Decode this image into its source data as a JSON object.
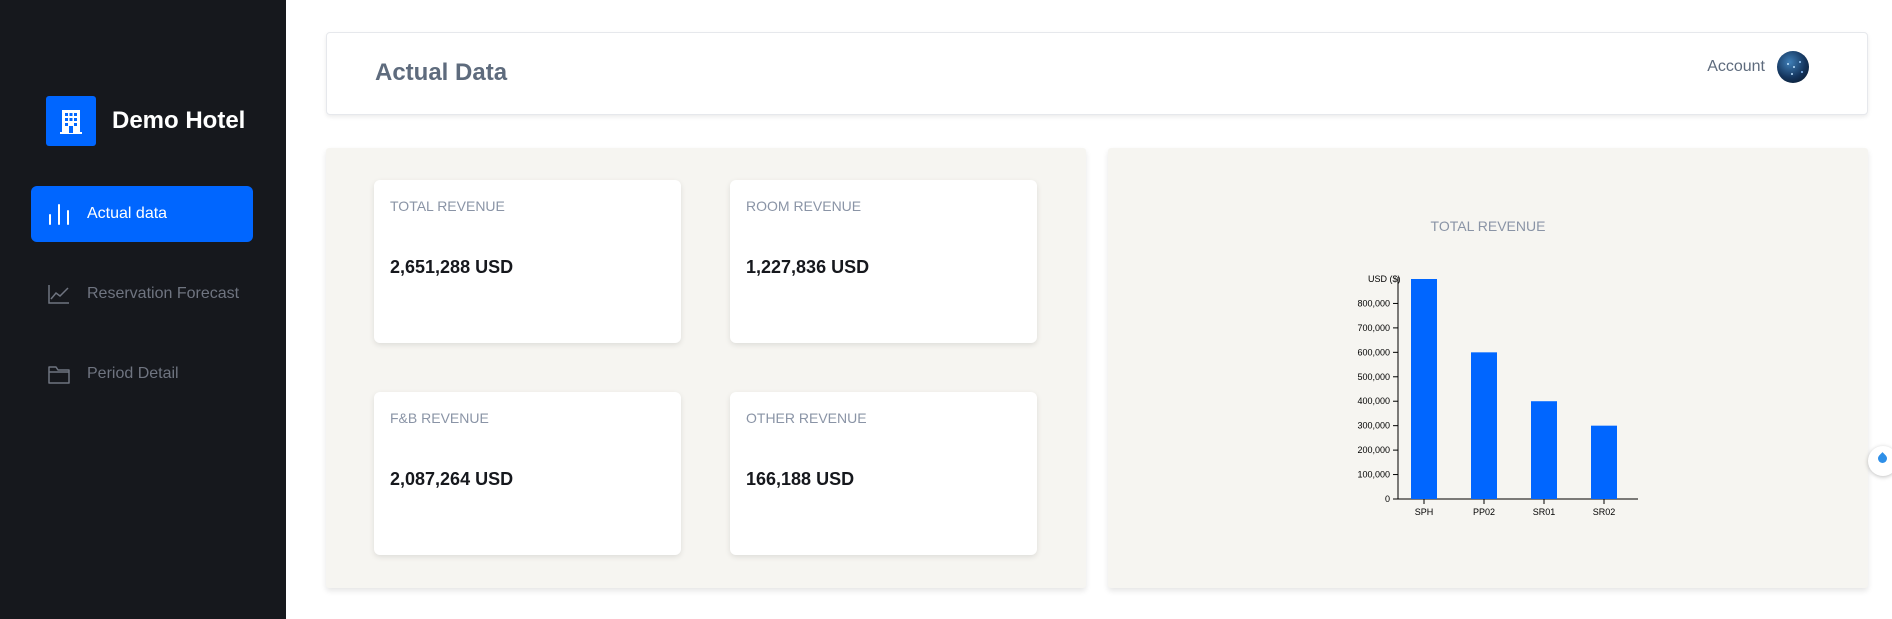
{
  "sidebar": {
    "brand_name": "Demo Hotel",
    "brand_icon": "hotel-building-icon",
    "items": [
      {
        "label": "Actual data",
        "icon": "bar-chart-icon",
        "active": true
      },
      {
        "label": "Reservation Forecast",
        "icon": "line-chart-icon",
        "active": false
      },
      {
        "label": "Period Detail",
        "icon": "folder-icon",
        "active": false
      }
    ]
  },
  "header": {
    "title": "Actual Data",
    "account_label": "Account"
  },
  "cards": [
    {
      "label": "TOTAL REVENUE",
      "value": "2,651,288 USD"
    },
    {
      "label": "ROOM REVENUE",
      "value": "1,227,836 USD"
    },
    {
      "label": "F&B REVENUE",
      "value": "2,087,264 USD"
    },
    {
      "label": "OTHER REVENUE",
      "value": "166,188 USD"
    }
  ],
  "colors": {
    "accent": "#0066ff",
    "sidebar_bg": "#16181d",
    "panel_bg": "#f6f5f1"
  },
  "chart_data": {
    "type": "bar",
    "title": "TOTAL REVENUE",
    "ylabel": "USD ($)",
    "xlabel": "",
    "categories": [
      "SPH",
      "PP02",
      "SR01",
      "SR02"
    ],
    "values": [
      900000,
      600000,
      400000,
      300000
    ],
    "ylim": [
      0,
      900000
    ],
    "yticks": [
      0,
      100000,
      200000,
      300000,
      400000,
      500000,
      600000,
      700000,
      800000
    ],
    "ytick_labels": [
      "0",
      "100,000",
      "200,000",
      "300,000",
      "400,000",
      "500,000",
      "600,000",
      "700,000",
      "800,000"
    ],
    "grid": false,
    "bar_color": "#0066ff"
  }
}
